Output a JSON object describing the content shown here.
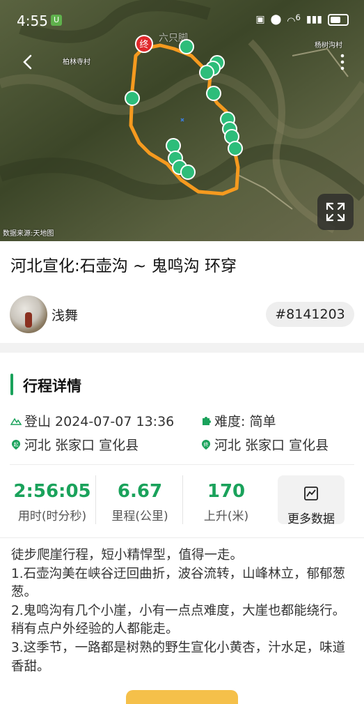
{
  "status_bar": {
    "time": "4:55",
    "app_badge": "U",
    "signal_text": "6",
    "icons": [
      "nfc-icon",
      "location-icon",
      "wifi-icon",
      "signal-icon",
      "battery-icon"
    ]
  },
  "map": {
    "watermark": "六只脚",
    "place_labels": [
      "柏林寺村",
      "杨树沟村"
    ],
    "end_marker": "终",
    "data_source": "数据来源:天地图",
    "colors": {
      "route": "#f59a1f",
      "photo_marker": "#2dbd7a",
      "end_marker": "#e0282b"
    }
  },
  "trip": {
    "title": "河北宣化:石壶沟 ~ 鬼鸣沟  环穿",
    "author": "浅舞",
    "id": "#8141203"
  },
  "details": {
    "section_title": "行程详情",
    "activity": "登山 2024-07-07 13:36",
    "difficulty": "难度:  简单",
    "start_location": "河北 张家口 宣化县",
    "end_location": "河北 张家口 宣化县",
    "start_badge": "起",
    "end_badge": "终",
    "stats": [
      {
        "value": "2:56:05",
        "label": "用时(时分秒)"
      },
      {
        "value": "6.67",
        "label": "里程(公里)"
      },
      {
        "value": "170",
        "label": "上升(米)"
      }
    ],
    "more_data_label": "更多数据",
    "accent_color": "#1aa25b"
  },
  "description": [
    "徒步爬崖行程，短小精悍型，值得一走。",
    "1.石壶沟美在峡谷迂回曲折，波谷流转，山峰林立，郁郁葱葱。",
    "2.鬼鸣沟有几个小崖，小有一点点难度，大崖也都能绕行。稍有点户外经验的人都能走。",
    "3.这季节，一路都是树熟的野生宣化小黄杏，汁水足，味道香甜。"
  ]
}
